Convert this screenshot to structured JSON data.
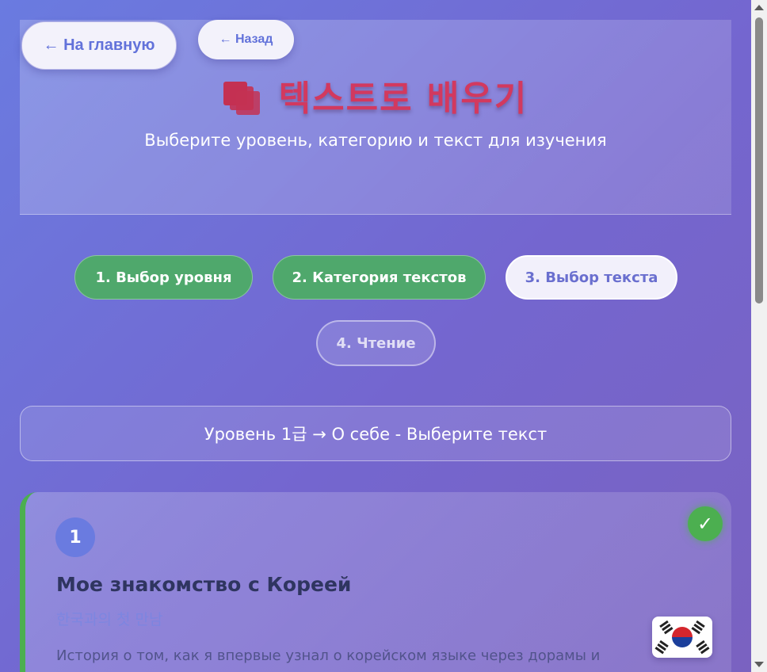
{
  "nav": {
    "home_label": "← На главную",
    "back_label": "← Назад"
  },
  "header": {
    "title_icon": "books-icon",
    "title": "텍스트로 배우기",
    "subtitle": "Выберите уровень, категорию и текст для изучения"
  },
  "steps": [
    {
      "label": "1. Выбор уровня",
      "state": "done"
    },
    {
      "label": "2. Категория текстов",
      "state": "done"
    },
    {
      "label": "3. Выбор текста",
      "state": "active"
    },
    {
      "label": "4. Чтение",
      "state": "todo"
    }
  ],
  "breadcrumb": "Уровень 1급 → О себе - Выберите текст",
  "texts": [
    {
      "number": "1",
      "title": "Мое знакомство с Кореей",
      "korean_title": "한국과의 첫 만남",
      "description": "История о том, как я впервые узнал о корейском языке через дорамы и",
      "completed": true,
      "completed_icon": "check-icon",
      "flag_icon": "korean-flag-icon"
    }
  ],
  "colors": {
    "accent": "#6272da",
    "done": "#4fa86c",
    "title_red": "#d2395f"
  }
}
